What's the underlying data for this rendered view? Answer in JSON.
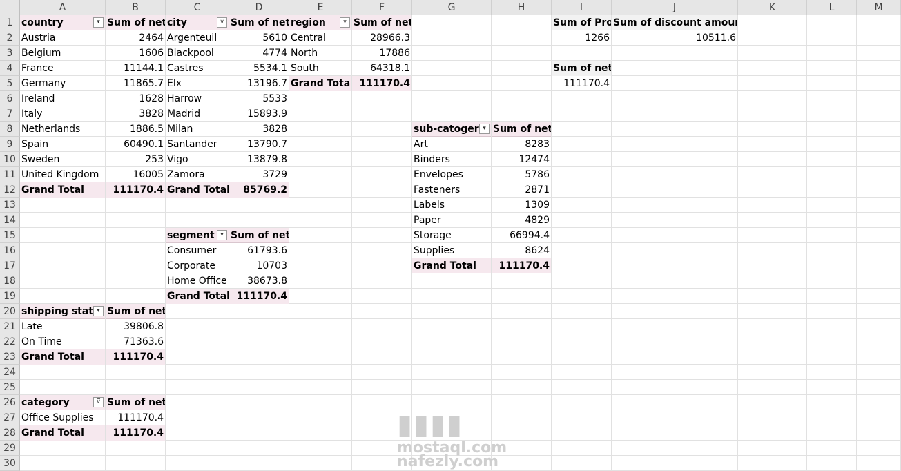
{
  "columns": [
    "A",
    "B",
    "C",
    "D",
    "E",
    "F",
    "G",
    "H",
    "I",
    "J",
    "K",
    "L",
    "M"
  ],
  "rows": [
    "1",
    "2",
    "3",
    "4",
    "5",
    "6",
    "7",
    "8",
    "9",
    "10",
    "11",
    "12",
    "13",
    "14",
    "15",
    "16",
    "17",
    "18",
    "19",
    "20",
    "21",
    "22",
    "23",
    "24",
    "25",
    "26",
    "27",
    "28",
    "29",
    "30"
  ],
  "country_pivot": {
    "header_label": "country",
    "value_label": "Sum of net",
    "rows": [
      {
        "label": "Austria",
        "value": "2464"
      },
      {
        "label": "Belgium",
        "value": "1606"
      },
      {
        "label": "France",
        "value": "11144.1"
      },
      {
        "label": "Germany",
        "value": "11865.7"
      },
      {
        "label": "Ireland",
        "value": "1628"
      },
      {
        "label": "Italy",
        "value": "3828"
      },
      {
        "label": "Netherlands",
        "value": "1886.5"
      },
      {
        "label": "Spain",
        "value": "60490.1"
      },
      {
        "label": "Sweden",
        "value": "253"
      },
      {
        "label": "United Kingdom",
        "value": "16005"
      }
    ],
    "total_label": "Grand Total",
    "total_value": "111170.4"
  },
  "city_pivot": {
    "header_label": "city",
    "value_label": "Sum of net",
    "rows": [
      {
        "label": "Argenteuil",
        "value": "5610"
      },
      {
        "label": "Blackpool",
        "value": "4774"
      },
      {
        "label": "Castres",
        "value": "5534.1"
      },
      {
        "label": "Elx",
        "value": "13196.7"
      },
      {
        "label": "Harrow",
        "value": "5533"
      },
      {
        "label": "Madrid",
        "value": "15893.9"
      },
      {
        "label": "Milan",
        "value": "3828"
      },
      {
        "label": "Santander",
        "value": "13790.7"
      },
      {
        "label": "Vigo",
        "value": "13879.8"
      },
      {
        "label": "Zamora",
        "value": "3729"
      }
    ],
    "total_label": "Grand Total",
    "total_value": "85769.2"
  },
  "region_pivot": {
    "header_label": "region",
    "value_label": "Sum of net",
    "rows": [
      {
        "label": "Central",
        "value": "28966.3"
      },
      {
        "label": "North",
        "value": "17886"
      },
      {
        "label": "South",
        "value": "64318.1"
      }
    ],
    "total_label": "Grand Total",
    "total_value": "111170.4"
  },
  "profit_discount": {
    "profit_label": "Sum of Prof",
    "discount_label": "Sum of discount amount",
    "profit_value": "1266",
    "discount_value": "10511.6"
  },
  "net_summary": {
    "label": "Sum of net",
    "value": "111170.4"
  },
  "subcategory_pivot": {
    "header_label": "sub-catogery",
    "value_label": "Sum of net",
    "rows": [
      {
        "label": "Art",
        "value": "8283"
      },
      {
        "label": "Binders",
        "value": "12474"
      },
      {
        "label": "Envelopes",
        "value": "5786"
      },
      {
        "label": "Fasteners",
        "value": "2871"
      },
      {
        "label": "Labels",
        "value": "1309"
      },
      {
        "label": "Paper",
        "value": "4829"
      },
      {
        "label": "Storage",
        "value": "66994.4"
      },
      {
        "label": "Supplies",
        "value": "8624"
      }
    ],
    "total_label": "Grand Total",
    "total_value": "111170.4"
  },
  "segment_pivot": {
    "header_label": "segment",
    "value_label": "Sum of net",
    "rows": [
      {
        "label": "Consumer",
        "value": "61793.6"
      },
      {
        "label": "Corporate",
        "value": "10703"
      },
      {
        "label": "Home Office",
        "value": "38673.8"
      }
    ],
    "total_label": "Grand Total",
    "total_value": "111170.4"
  },
  "shipping_pivot": {
    "header_label": "shipping state",
    "value_label": "Sum of net",
    "rows": [
      {
        "label": "Late",
        "value": "39806.8"
      },
      {
        "label": "On Time",
        "value": "71363.6"
      }
    ],
    "total_label": "Grand Total",
    "total_value": "111170.4"
  },
  "category_pivot": {
    "header_label": "category",
    "value_label": "Sum of net",
    "rows": [
      {
        "label": " Office Supplies",
        "value": "111170.4"
      }
    ],
    "total_label": "Grand Total",
    "total_value": "111170.4"
  },
  "filter_icons": {
    "dropdown": "dropdown-arrow-icon",
    "filtered": "filter-applied-icon"
  },
  "watermark": {
    "line1": "mostaql.com",
    "line2": "nafezly.com"
  },
  "colors": {
    "pivot_highlight": "#f6e8ee",
    "header_bg": "#e6e6e6",
    "grid": "#e1e1e1"
  }
}
